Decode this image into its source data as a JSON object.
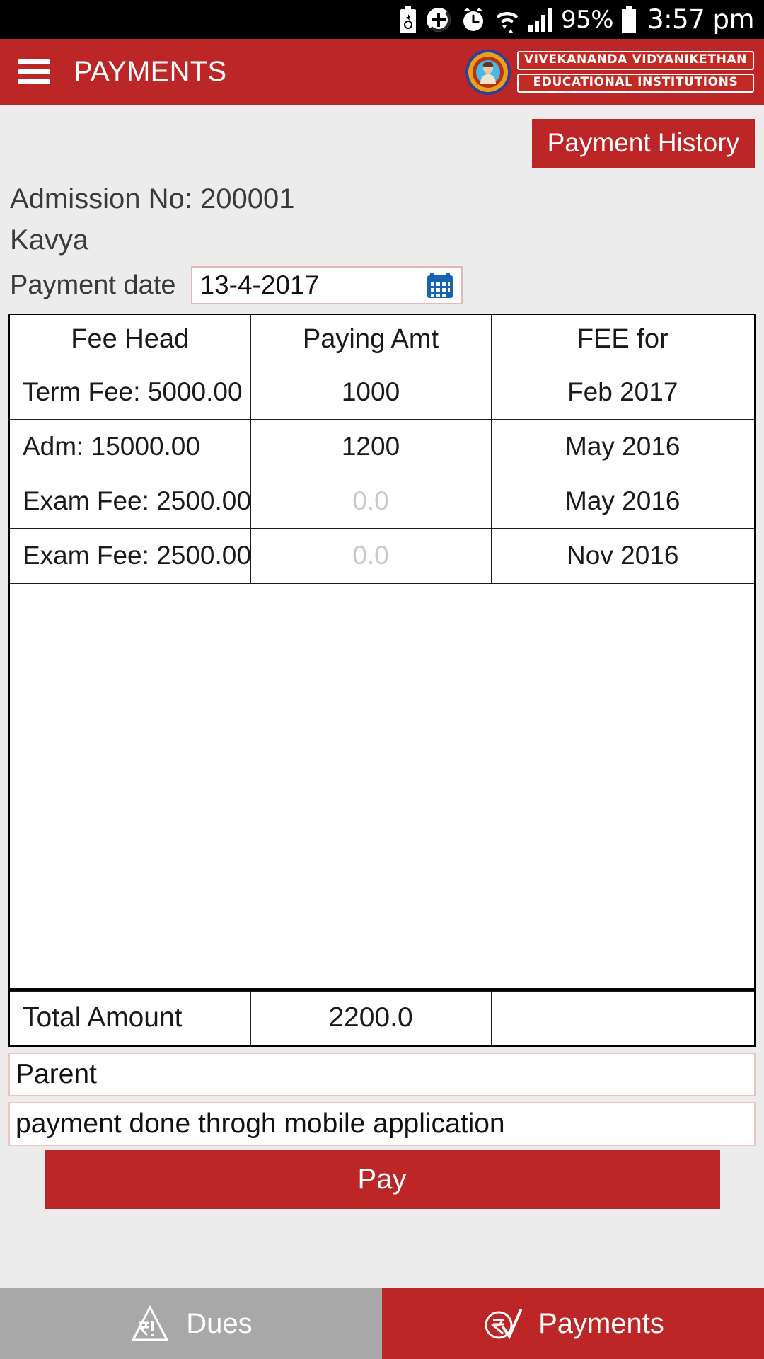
{
  "status_bar": {
    "battery_percent": "95%",
    "time": "3:57 pm",
    "icons": [
      "battery-saver-icon",
      "power-save-icon",
      "alarm-clock-icon",
      "wifi-icon",
      "signal-bars-icon",
      "battery-icon"
    ]
  },
  "app_bar": {
    "menu_icon": "hamburger-menu-icon",
    "title": "PAYMENTS",
    "logo": {
      "emblem_icon": "school-emblem-icon",
      "line1": "VIVEKANANDA VIDYANIKETHAN",
      "line2": "EDUCATIONAL INSTITUTIONS"
    }
  },
  "main": {
    "payment_history_label": "Payment History",
    "admission_line": "Admission No: 200001",
    "student_name": "Kavya",
    "payment_date_label": "Payment date",
    "payment_date_value": "13-4-2017",
    "calendar_icon": "calendar-icon",
    "table": {
      "headers": [
        "Fee Head",
        "Paying Amt",
        "FEE for"
      ],
      "rows": [
        {
          "fee_head": "Term Fee: 5000.00",
          "paying_amt": "1000",
          "fee_for": "Feb 2017",
          "amt_is_placeholder": false
        },
        {
          "fee_head": "Adm: 15000.00",
          "paying_amt": "1200",
          "fee_for": "May 2016",
          "amt_is_placeholder": false
        },
        {
          "fee_head": "Exam Fee: 2500.00",
          "paying_amt": "0.0",
          "fee_for": "May 2016",
          "amt_is_placeholder": true
        },
        {
          "fee_head": "Exam Fee: 2500.00",
          "paying_amt": "0.0",
          "fee_for": "Nov 2016",
          "amt_is_placeholder": true
        }
      ],
      "total_label": "Total Amount",
      "total_value": "2200.0",
      "total_third_cell": ""
    },
    "payer_field_value": "Parent",
    "remarks_field_value": "payment done throgh mobile application",
    "pay_button_label": "Pay"
  },
  "tab_bar": {
    "tabs": [
      {
        "label": "Dues",
        "icon": "rupee-warning-icon",
        "active": false
      },
      {
        "label": "Payments",
        "icon": "rupee-check-icon",
        "active": true
      }
    ]
  },
  "colors": {
    "brand_red": "#bc2626",
    "page_bg": "#ececec",
    "inactive_tab": "#a8a8a8",
    "input_border": "#e7b7b7",
    "calendar_blue": "#1565b0",
    "placeholder_grey": "#c9c9c9"
  }
}
